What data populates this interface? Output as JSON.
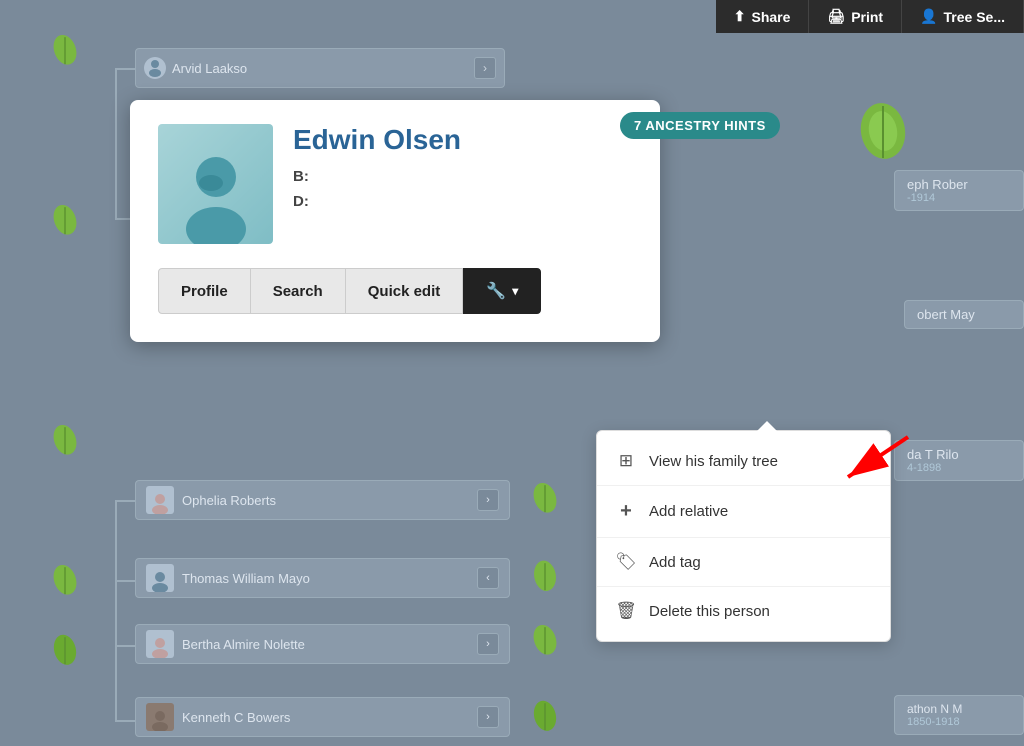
{
  "header": {
    "share_label": "Share",
    "print_label": "Print",
    "tree_search_label": "Tree Se..."
  },
  "hints_badge": {
    "label": "7 ANCESTRY HINTS"
  },
  "person_card": {
    "name": "Edwin Olsen",
    "birth_label": "B:",
    "birth_value": "",
    "death_label": "D:",
    "death_value": "",
    "buttons": {
      "profile": "Profile",
      "search": "Search",
      "quick_edit": "Quick edit"
    }
  },
  "background_nodes": {
    "arvid": "Arvid Laakso",
    "ophelia": "Ophelia Roberts",
    "thomas": "Thomas William Mayo",
    "bertha": "Bertha Almire Nolette",
    "kenneth": "Kenneth C Bowers",
    "right1": "eph Rober",
    "right1_dates": "-1914",
    "right2": "obert May",
    "right3": "da T Rilo",
    "right3_dates": "4-1898",
    "right4_dates": "athon N M",
    "right4_sub": "1850-1918"
  },
  "dropdown": {
    "view_family_tree": "View his family tree",
    "add_relative": "Add relative",
    "add_tag": "Add tag",
    "delete_person": "Delete this person"
  },
  "icons": {
    "family_tree": "⊞",
    "add": "+",
    "tag": "🏷",
    "trash": "🗑"
  }
}
